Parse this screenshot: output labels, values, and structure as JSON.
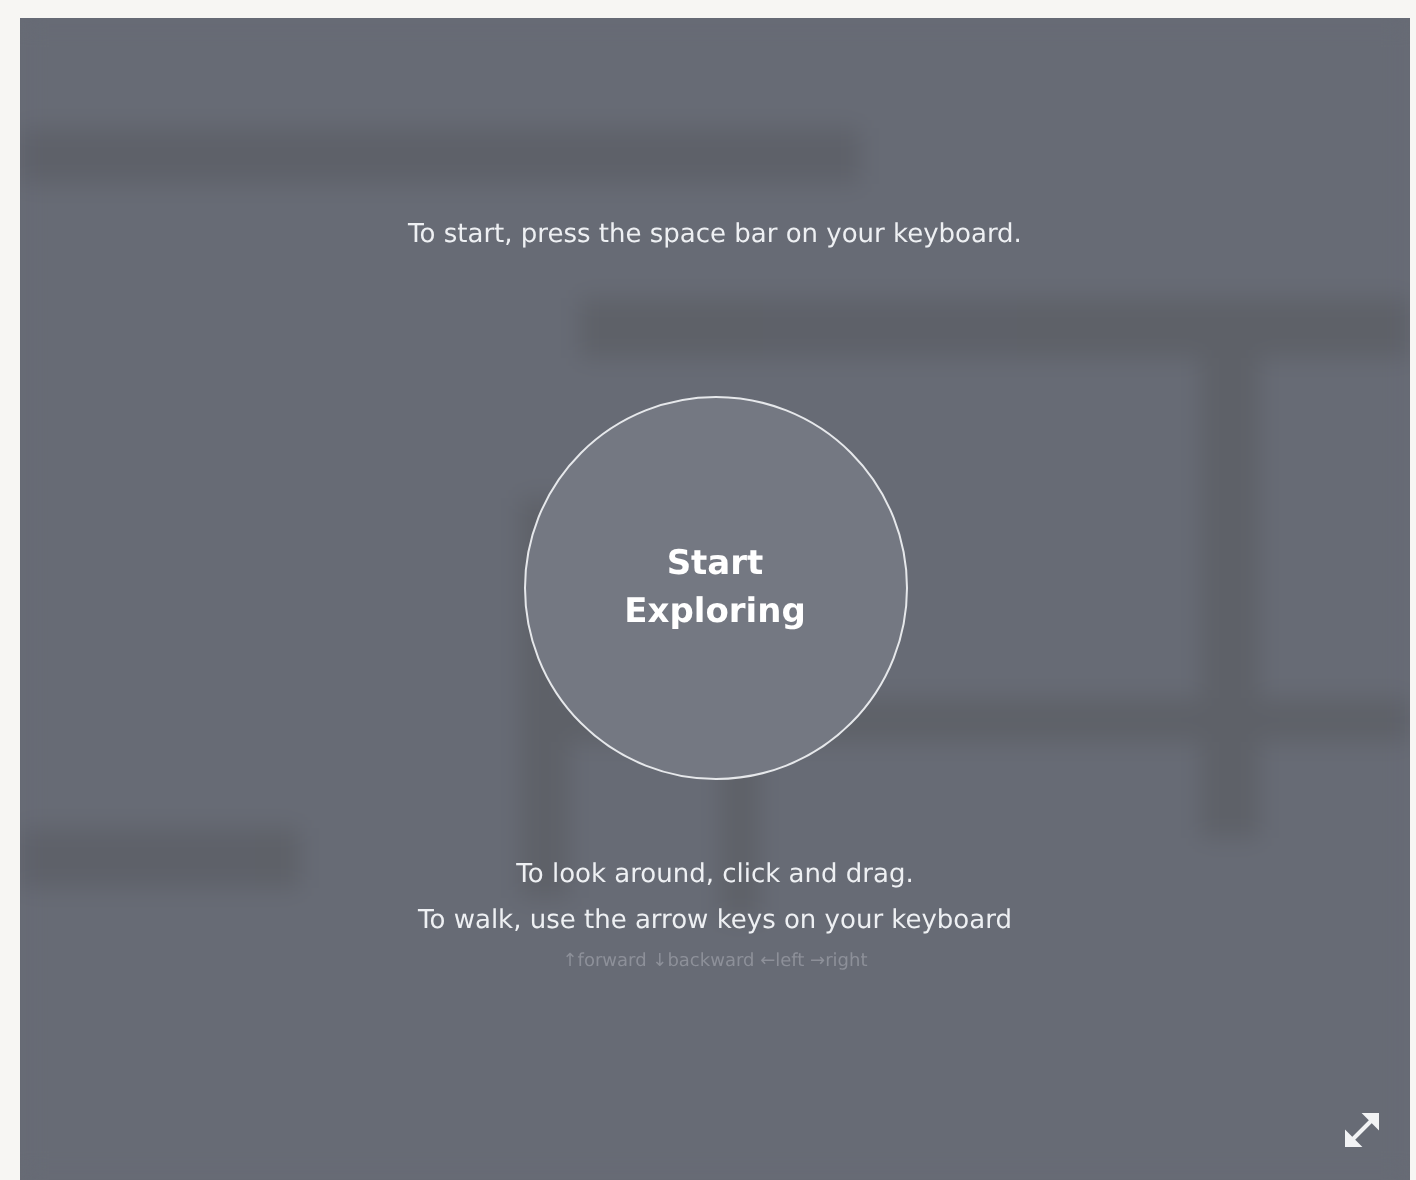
{
  "intro": "To start, press the space bar on your keyboard.",
  "start_button": {
    "lines": [
      "Start",
      "Exploring"
    ]
  },
  "instructions": [
    "To look around, click and drag.",
    "To walk, use the arrow keys on your keyboard"
  ],
  "key_hint": "↑forward ↓backward ←left →right"
}
